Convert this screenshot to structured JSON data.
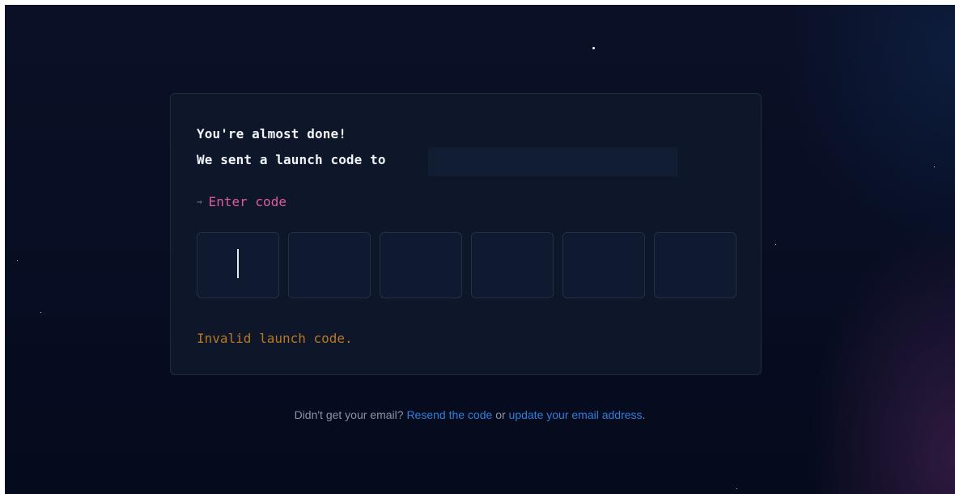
{
  "card": {
    "heading": "You're almost done!",
    "sent_text": "We sent a launch code to",
    "prompt_arrow": "→",
    "prompt_label": "Enter code",
    "error_text": "Invalid launch code."
  },
  "code_inputs": [
    "",
    "",
    "",
    "",
    "",
    ""
  ],
  "footer": {
    "question": "Didn't get your email?",
    "resend_link": "Resend the code",
    "or_text": "or",
    "update_link": "update your email address",
    "period": "."
  },
  "colors": {
    "background": "#070d22",
    "card": "#0e1629",
    "prompt": "#e05aa4",
    "error": "#b8781f",
    "link": "#2f7fdb"
  }
}
